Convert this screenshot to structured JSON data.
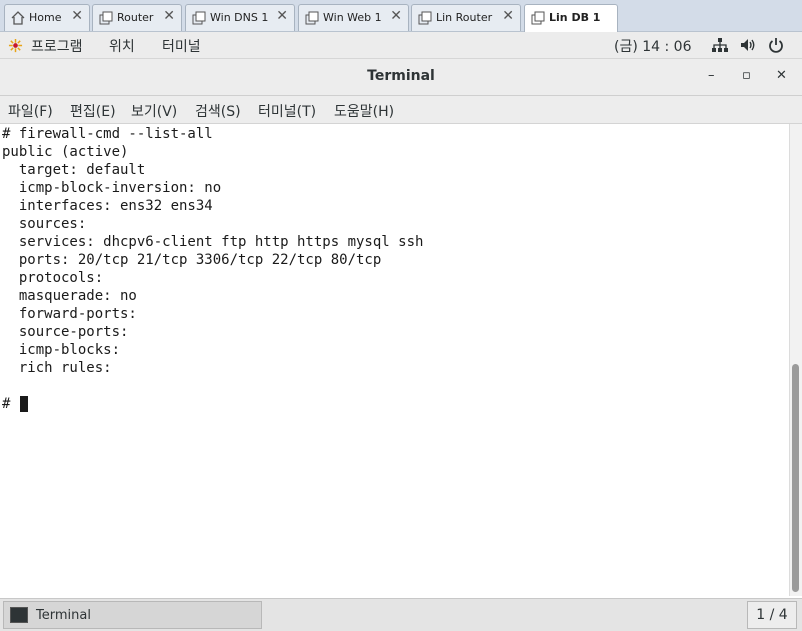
{
  "vm_tabs": [
    {
      "label": "Home",
      "icon": "home-icon",
      "active": false
    },
    {
      "label": "Router",
      "icon": "vm-icon",
      "active": false
    },
    {
      "label": "Win DNS 1",
      "icon": "vm-icon",
      "active": false
    },
    {
      "label": "Win Web 1",
      "icon": "vm-icon",
      "active": false
    },
    {
      "label": "Lin Router",
      "icon": "vm-icon",
      "active": false
    },
    {
      "label": "Lin DB 1",
      "icon": "vm-icon",
      "active": true
    }
  ],
  "topbar": {
    "programs": "프로그램",
    "places": "위치",
    "terminal": "터미널",
    "clock": "(금) 14 : 06",
    "status_icons": [
      "network-icon",
      "volume-icon",
      "power-icon"
    ]
  },
  "window": {
    "title": "Terminal",
    "minimize": "–",
    "maximize": "▫",
    "close": "✕"
  },
  "menu": [
    "파일(F)",
    "편집(E)",
    "보기(V)",
    "검색(S)",
    "터미널(T)",
    "도움말(H)"
  ],
  "terminal_lines": [
    "# firewall-cmd --list-all",
    "public (active)",
    "  target: default",
    "  icmp-block-inversion: no",
    "  interfaces: ens32 ens34",
    "  sources:",
    "  services: dhcpv6-client ftp http https mysql ssh",
    "  ports: 20/tcp 21/tcp 3306/tcp 22/tcp 80/tcp",
    "  protocols:",
    "  masquerade: no",
    "  forward-ports:",
    "  source-ports:",
    "  icmp-blocks:",
    "  rich rules:",
    "",
    "#"
  ],
  "taskbar": {
    "task_label": "Terminal",
    "workspace": "1 / 4"
  }
}
